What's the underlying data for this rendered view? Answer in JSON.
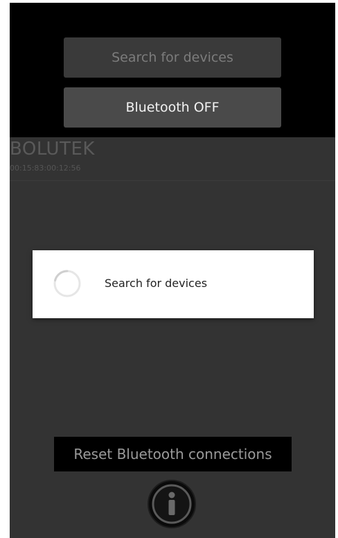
{
  "buttons": {
    "search_label": "Search for devices",
    "bluetooth_label": "Bluetooth OFF"
  },
  "device": {
    "name": "BOLUTEK",
    "mac": "00:15:83:00:12:56"
  },
  "dialog": {
    "message": "Search for devices"
  },
  "footer": {
    "reset_label": "Reset Bluetooth connections"
  },
  "icons": {
    "spinner": "loading-spinner-icon",
    "info": "info-icon"
  }
}
